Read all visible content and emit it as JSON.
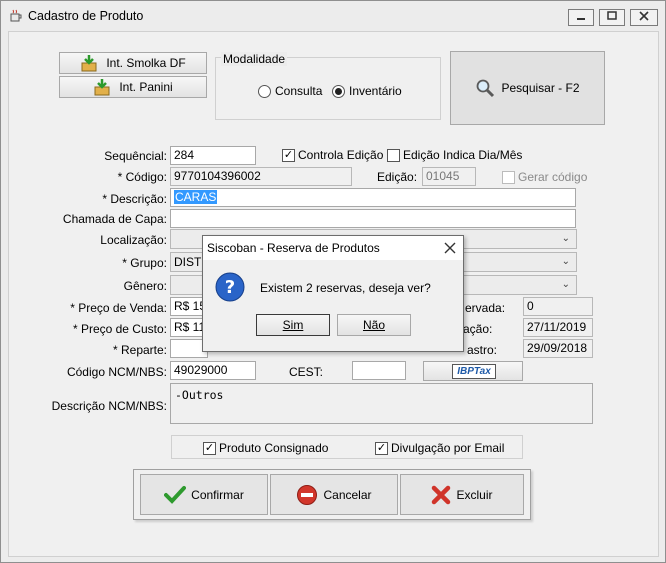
{
  "window": {
    "title": "Cadastro de Produto",
    "app_icon": "coffee-cup-icon",
    "controls": {
      "minimize": "minimize-icon",
      "maximize": "maximize-icon",
      "close": "close-icon"
    }
  },
  "integrations": {
    "smolka_label": "Int. Smolka DF",
    "panini_label": "Int. Panini",
    "icon": "box-download-icon"
  },
  "modalidade": {
    "title": "Modalidade",
    "options": [
      "Consulta",
      "Inventário"
    ],
    "selected": "Inventário"
  },
  "search": {
    "label": "Pesquisar - F2",
    "icon": "magnifier-icon"
  },
  "form": {
    "sequencial_label": "Sequêncial:",
    "sequencial_value": "284",
    "controla_edicao_label": "Controla Edição",
    "controla_edicao_checked": true,
    "edicao_dia_mes_label": "Edição Indica Dia/Mês",
    "edicao_dia_mes_checked": false,
    "codigo_label": "* Código:",
    "codigo_value": "9770104396002",
    "edicao_label": "Edição:",
    "edicao_value": "01045",
    "gerar_codigo_label": "Gerar código",
    "descricao_label": "* Descrição:",
    "descricao_value": "CARAS",
    "chamada_label": "Chamada de Capa:",
    "chamada_value": "",
    "localizacao_label": "Localização:",
    "localizacao_value": "",
    "grupo_label": "* Grupo:",
    "grupo_value": "DISTR",
    "genero_label": "Gênero:",
    "genero_value": "",
    "preco_venda_label": "* Preço de Venda:",
    "preco_venda_value": "R$ 15",
    "reservada_label": "ervada:",
    "reservada_value": "0",
    "preco_custo_label": "* Preço de Custo:",
    "preco_custo_value": "R$ 11",
    "atualizacao_label": "zação:",
    "atualizacao_value": "27/11/2019",
    "reparte_label": "* Reparte:",
    "reparte_value": "",
    "cadastro_label": "astro:",
    "cadastro_value": "29/09/2018",
    "ncm_label": "Código NCM/NBS:",
    "ncm_value": "49029000",
    "cest_label": "CEST:",
    "cest_value": "",
    "ibptax_label": "IBPTax",
    "desc_ncm_label": "Descrição NCM/NBS:",
    "desc_ncm_value": "-Outros",
    "consignado_label": "Produto Consignado",
    "consignado_checked": true,
    "divulgacao_label": "Divulgação por Email",
    "divulgacao_checked": true
  },
  "actions": {
    "confirmar": "Confirmar",
    "cancelar": "Cancelar",
    "excluir": "Excluir"
  },
  "dialog": {
    "title": "Siscoban - Reserva de Produtos",
    "message": "Existem 2 reservas, deseja ver?",
    "yes": "Sim",
    "no": "Não",
    "icon": "question-icon"
  },
  "colors": {
    "selection": "#3399ff",
    "confirm_green": "#2e9a2e",
    "cancel_red": "#d2362b",
    "question_blue": "#2a64c8"
  }
}
